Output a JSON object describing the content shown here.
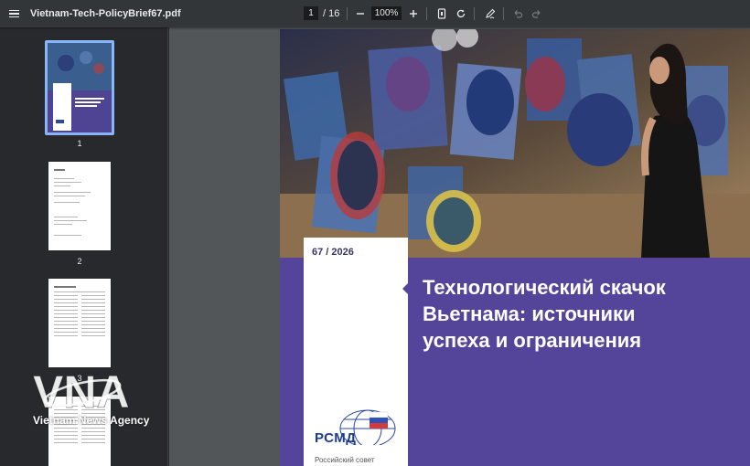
{
  "toolbar": {
    "file_name": "Vietnam-Tech-PolicyBrief67.pdf",
    "current_page": "1",
    "total_pages": "/ 16",
    "zoom": "100%",
    "zoom_out_icon": "minus-icon",
    "zoom_in_icon": "plus-icon"
  },
  "sidebar": {
    "thumbnails": [
      {
        "label": "1",
        "selected": true
      },
      {
        "label": "2",
        "selected": false
      },
      {
        "label": "3",
        "selected": false
      },
      {
        "label": "",
        "selected": false
      }
    ]
  },
  "cover": {
    "issue": "67 / 2026",
    "title_lines": [
      "Технологический скачок",
      "Вьетнама: источники",
      "успеха и ограничения"
    ],
    "logo_text": "РСМД",
    "logo_subtext": "Российский совет"
  },
  "watermark": {
    "text": "Vietnam News Agency",
    "logo_letters": "VNA"
  },
  "colors": {
    "toolbar": "#323639",
    "sidebar": "#27292c",
    "viewer": "#525659",
    "cover_purple": "#54459a",
    "selection": "#8ab4f8"
  }
}
